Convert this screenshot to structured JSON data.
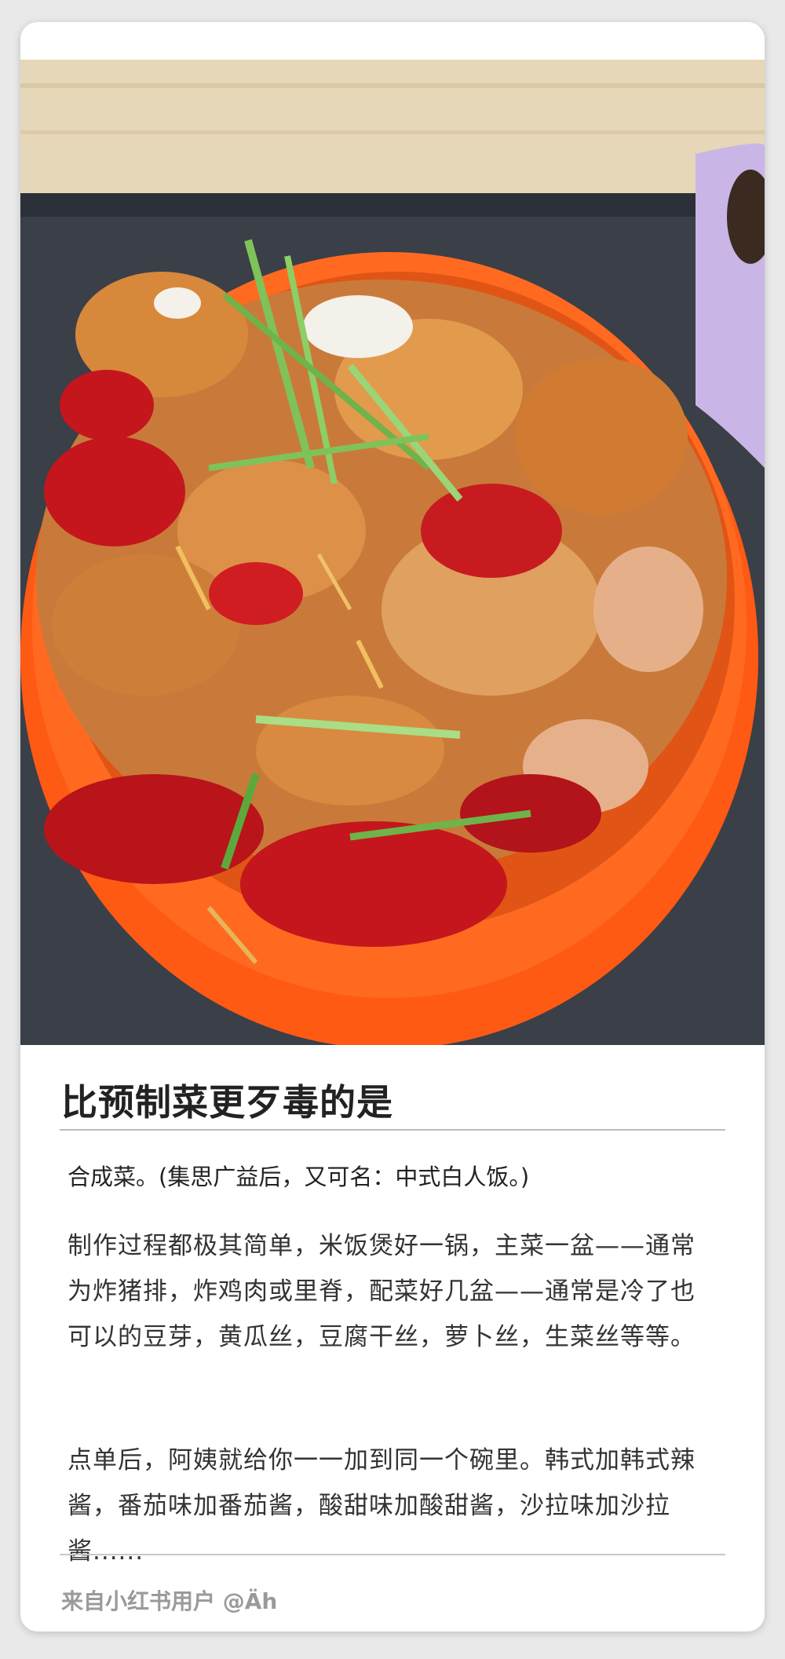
{
  "post": {
    "title": "比预制菜更歹毒的是",
    "subtitle": "合成菜。(集思广益后，又可名：中式白人饭。)",
    "paragraph1": "制作过程都极其简单，米饭煲好一锅，主菜一盆——通常为炸猪排，炸鸡肉或里脊，配菜好几盆——通常是冷了也可以的豆芽，黄瓜丝，豆腐干丝，萝卜丝，生菜丝等等。",
    "paragraph2": "点单后，阿姨就给你一一加到同一个碗里。韩式加韩式辣酱，番茄味加番茄酱，酸甜味加酸甜酱，沙拉味加沙拉酱......",
    "footer": "来自小红书用户 @Äh"
  },
  "colors": {
    "bowl": "#ff5a14",
    "bowl_inner": "#ff6a20",
    "tray": "#3a3f48",
    "table": "#e6d7b8",
    "cup": "#c9b6e6",
    "sauce": "#c4161c",
    "fried": "#d8883a",
    "cucumber": "#7fc25a"
  }
}
